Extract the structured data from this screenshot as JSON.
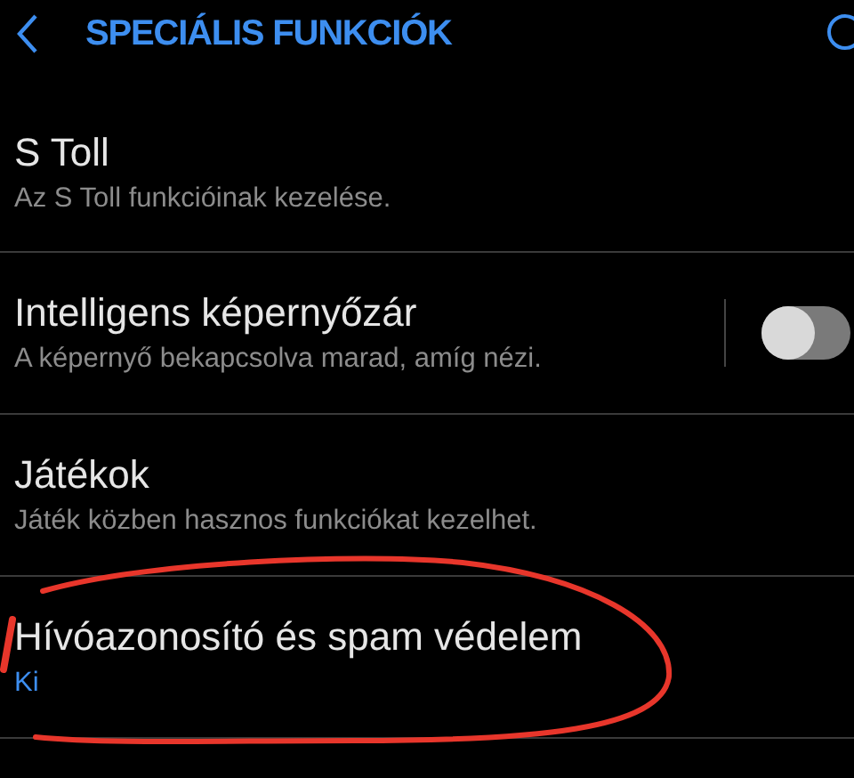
{
  "header": {
    "title": "SPECIÁLIS FUNKCIÓK"
  },
  "items": [
    {
      "kind": "link",
      "title": "S Toll",
      "description": "Az S Toll funkcióinak kezelése.",
      "circled": false
    },
    {
      "kind": "toggle",
      "title": "Intelligens képernyőzár",
      "description": "A képernyő bekapcsolva marad, amíg nézi.",
      "on": false,
      "circled": false
    },
    {
      "kind": "link",
      "title": "Játékok",
      "description": "Játék közben hasznos funkciókat kezelhet.",
      "circled": false
    },
    {
      "kind": "status",
      "title": "Hívóazonosító és spam védelem",
      "value": "Ki",
      "circled": true
    }
  ]
}
